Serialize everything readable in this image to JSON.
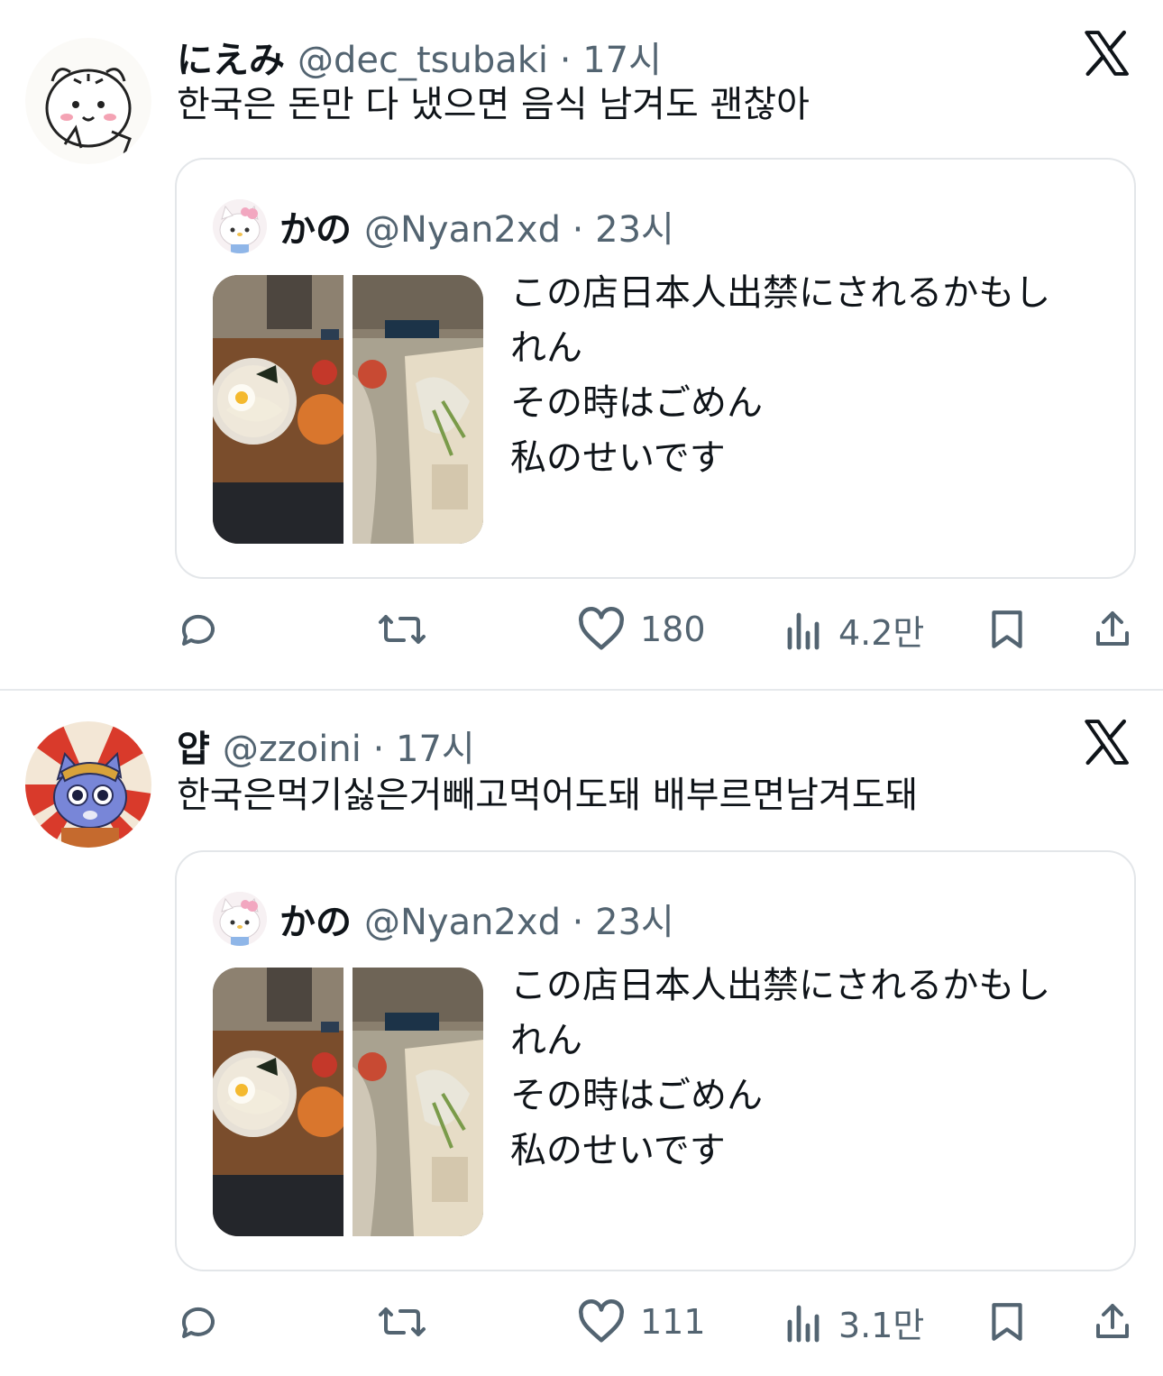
{
  "tweets": [
    {
      "author_name": "にえみ",
      "meta": "@dec_tsubaki · 17시",
      "text": "한국은 돈만 다 냈으면 음식 남겨도 괜찮아",
      "avatar_icon": "hamster-avatar-icon",
      "quote": {
        "author_name": "かの",
        "meta": "@Nyan2xd · 23시",
        "avatar_icon": "hello-kitty-avatar-icon",
        "lines": [
          "この店日本人出禁にされるかもし",
          "れん",
          "その時はごめん",
          "私のせいです"
        ]
      },
      "actions": {
        "likes": "180",
        "views": "4.2만"
      }
    },
    {
      "author_name": "얍",
      "meta": "@zzoini · 17시",
      "text": "한국은먹기싫은거빼고먹어도돼 배부르면남겨도돼",
      "avatar_icon": "blue-cat-avatar-icon",
      "quote": {
        "author_name": "かの",
        "meta": "@Nyan2xd · 23시",
        "avatar_icon": "hello-kitty-avatar-icon",
        "lines": [
          "この店日本人出禁にされるかもし",
          "れん",
          "その時はごめん",
          "私のせいです"
        ]
      },
      "actions": {
        "likes": "111",
        "views": "3.1만"
      }
    }
  ],
  "colors": {
    "text": "#0f1419",
    "secondary": "#536471",
    "border": "#e3e6e9"
  }
}
